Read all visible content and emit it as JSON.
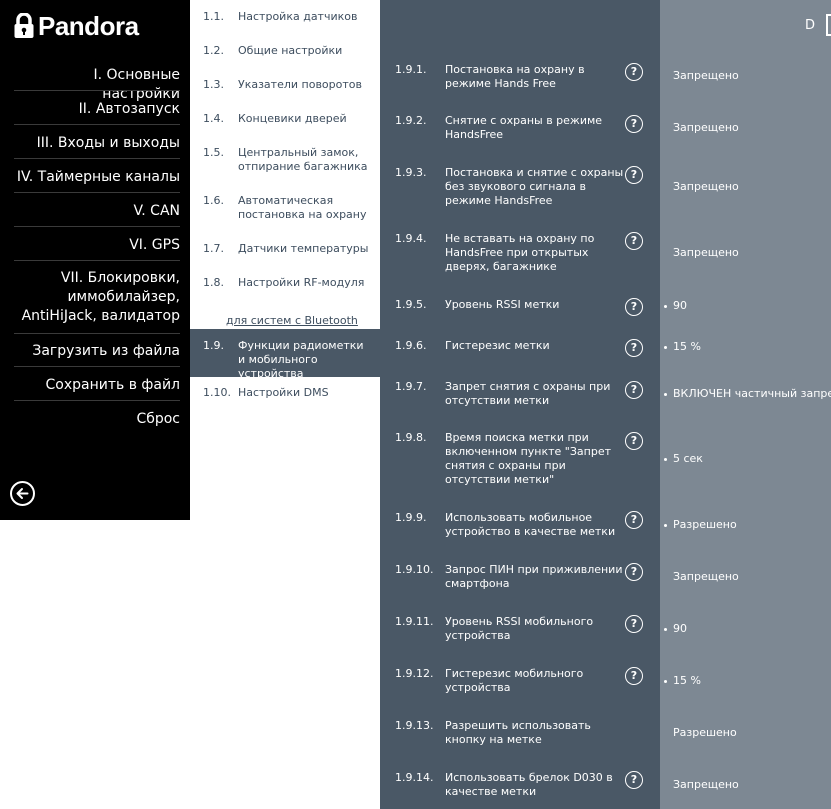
{
  "brand": {
    "name": "Pandora"
  },
  "sidebar": {
    "items": [
      {
        "label": "I. Основные настройки"
      },
      {
        "label": "II. Автозапуск"
      },
      {
        "label": "III. Входы и выходы"
      },
      {
        "label": "IV. Таймерные каналы"
      },
      {
        "label": "V. CAN"
      },
      {
        "label": "VI. GPS"
      },
      {
        "label": "VII. Блокировки, иммобилайзер, AntiHiJack, валидатор"
      },
      {
        "label": "Загрузить из файла"
      },
      {
        "label": "Сохранить в файл"
      },
      {
        "label": "Сброс"
      }
    ]
  },
  "submenu": {
    "items": [
      {
        "num": "1.1.",
        "label": "Настройка датчиков"
      },
      {
        "num": "1.2.",
        "label": "Общие настройки"
      },
      {
        "num": "1.3.",
        "label": "Указатели поворотов"
      },
      {
        "num": "1.4.",
        "label": "Концевики дверей"
      },
      {
        "num": "1.5.",
        "label": "Центральный замок, отпирание багажника"
      },
      {
        "num": "1.6.",
        "label": "Автоматическая постановка на охрану"
      },
      {
        "num": "1.7.",
        "label": "Датчики температуры"
      },
      {
        "num": "1.8.",
        "label": "Настройки RF-модуля"
      },
      {
        "num": "1.9.",
        "label": "Функции радиометки и мобильного устройства"
      },
      {
        "num": "1.10.",
        "label": "Настройки DMS"
      }
    ],
    "bluetooth_link": "для систем с Bluetooth"
  },
  "header": {
    "corner_letter": "D"
  },
  "settings": {
    "rows": [
      {
        "num": "1.9.1.",
        "label": "Постановка на охрану в режиме Hands Free",
        "value": "Запрещено",
        "dot": false
      },
      {
        "num": "1.9.2.",
        "label": "Снятие с охраны в режиме HandsFree",
        "value": "Запрещено",
        "dot": false
      },
      {
        "num": "1.9.3.",
        "label": "Постановка и снятие с охраны без звукового сигнала в режиме HandsFree",
        "value": "Запрещено",
        "dot": false
      },
      {
        "num": "1.9.4.",
        "label": "Не вставать на охрану по HandsFree при открытых дверях, багажнике",
        "value": "Запрещено",
        "dot": false
      },
      {
        "num": "1.9.5.",
        "label": "Уровень RSSI метки",
        "value": "90",
        "dot": true
      },
      {
        "num": "1.9.6.",
        "label": "Гистерезис метки",
        "value": "15  %",
        "dot": true
      },
      {
        "num": "1.9.7.",
        "label": "Запрет снятия с охраны при отсутствии метки",
        "value": "ВКЛЮЧЕН частичный запрет",
        "dot": true
      },
      {
        "num": "1.9.8.",
        "label": "Время поиска метки при включенном пункте \"Запрет снятия с охраны при отсутствии метки\"",
        "value": "5  сек",
        "dot": true
      },
      {
        "num": "1.9.9.",
        "label": "Использовать мобильное устройство в качестве метки",
        "value": "Разрешено",
        "dot": true
      },
      {
        "num": "1.9.10.",
        "label": "Запрос ПИН при приживлении смартфона",
        "value": "Запрещено",
        "dot": false
      },
      {
        "num": "1.9.11.",
        "label": "Уровень RSSI мобильного устройства",
        "value": "90",
        "dot": true
      },
      {
        "num": "1.9.12.",
        "label": "Гистерезис мобильного устройства",
        "value": "15  %",
        "dot": true
      },
      {
        "num": "1.9.13.",
        "label": "Разрешить использовать кнопку на метке",
        "value": "Разрешено",
        "dot": false
      },
      {
        "num": "1.9.14.",
        "label": "Использовать брелок D030 в качестве метки",
        "value": "Запрещено",
        "dot": false
      }
    ]
  },
  "icons": {
    "help": "?",
    "help_icon": "help-circle-icon",
    "back_icon": "arrow-left-circle-icon",
    "lock_icon": "padlock-icon"
  },
  "colors": {
    "sidebar_bg": "#000000",
    "content_bg": "#4a5866",
    "values_bg": "#7d8893",
    "submenu_text": "#3d4d5e"
  }
}
